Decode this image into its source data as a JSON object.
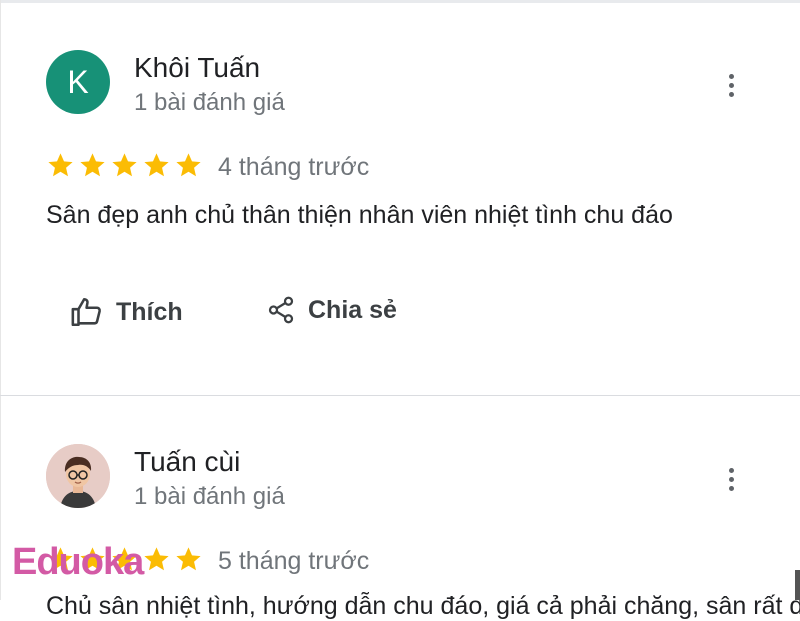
{
  "reviews": [
    {
      "avatar_letter": "K",
      "name": "Khôi Tuấn",
      "review_count": "1 bài đánh giá",
      "rating": 5,
      "date": "4 tháng trước",
      "text": "Sân đẹp anh chủ thân thiện nhân viên nhiệt tình chu đáo"
    },
    {
      "name": "Tuấn cùi",
      "review_count": "1 bài đánh giá",
      "rating": 5,
      "date": "5 tháng trước",
      "text": "Chủ sân nhiệt tình, hướng dẫn chu đáo, giá cả phải chăng, sân rất đẹp"
    }
  ],
  "actions": {
    "like_label": "Thích",
    "share_label": "Chia sẻ"
  },
  "watermark": "Eduoka",
  "colors": {
    "avatar_k": "#179177",
    "star": "#fbbc04",
    "watermark": "#d35aa5"
  },
  "icons": [
    "more-vert-icon",
    "thumb-up-icon",
    "share-icon",
    "star-icon"
  ]
}
